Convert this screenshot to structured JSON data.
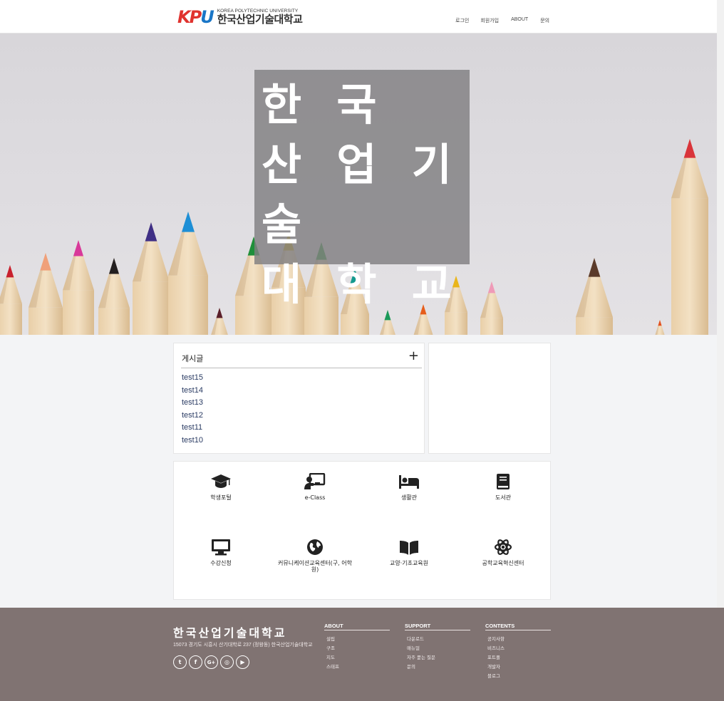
{
  "header": {
    "logo_mark": [
      "K",
      "P",
      "U"
    ],
    "logo_en": "KOREA POLYTECHNIC UNIVERSITY",
    "logo_ko": "한국산업기술대학교",
    "nav": [
      "로그인",
      "회원가입",
      "ABOUT",
      "문의"
    ]
  },
  "hero": {
    "title": "한 국\n산 업 기 술\n대 학 교"
  },
  "board": {
    "title": "게시글",
    "plus": "+",
    "posts": [
      "test15",
      "test14",
      "test13",
      "test12",
      "test11",
      "test10"
    ]
  },
  "quick_links": [
    {
      "label": "학생포털",
      "icon": "graduation-cap-icon"
    },
    {
      "label": "e-Class",
      "icon": "chalkboard-teacher-icon"
    },
    {
      "label": "생활관",
      "icon": "bed-icon"
    },
    {
      "label": "도서관",
      "icon": "book-icon"
    },
    {
      "label": "수강신청",
      "icon": "desktop-icon"
    },
    {
      "label": "커뮤니케이션교육센터(구, 어학원)",
      "icon": "globe-icon"
    },
    {
      "label": "교양·기초교육원",
      "icon": "book-open-icon"
    },
    {
      "label": "공학교육혁신센터",
      "icon": "atom-icon"
    }
  ],
  "footer": {
    "title": "한국산업기술대학교",
    "address": "15073 경기도 시흥시 산기대학로 237 (정왕동) 한국산업기술대학교",
    "social": [
      "twitter-icon",
      "facebook-icon",
      "google-plus-icon",
      "instagram-icon",
      "youtube-icon"
    ],
    "columns": [
      {
        "heading": "ABOUT",
        "items": [
          "설립",
          "구조",
          "지도",
          "스태프"
        ]
      },
      {
        "heading": "SUPPORT",
        "items": [
          "다운로드",
          "매뉴얼",
          "자주 묻는 질문",
          "문의"
        ]
      },
      {
        "heading": "CONTENTS",
        "items": [
          "공지사항",
          "비즈니스",
          "포트폴",
          "개발자",
          "블로그"
        ]
      }
    ]
  },
  "colors": {
    "footer_bg": "#807372",
    "hero_box": "#807f81",
    "link": "#2a3b63"
  }
}
